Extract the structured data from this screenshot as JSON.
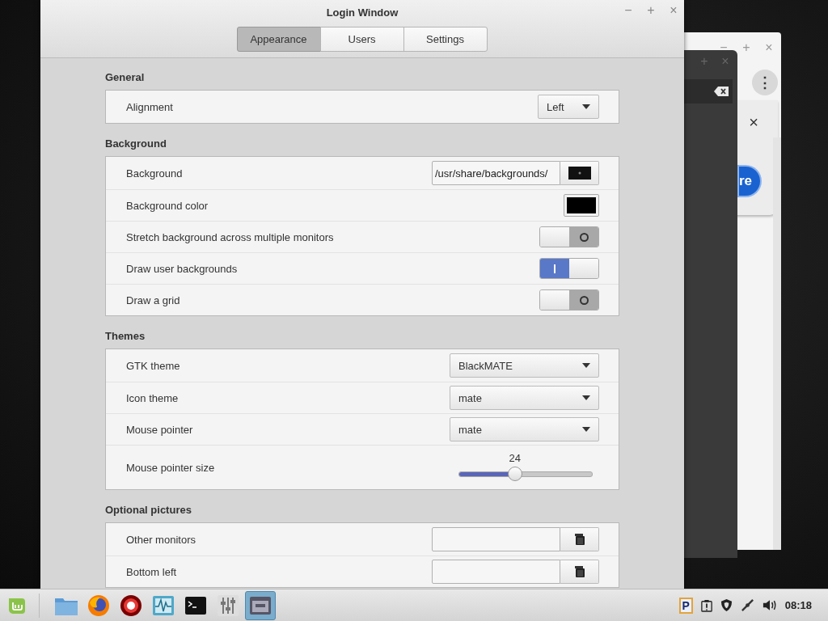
{
  "window": {
    "title": "Login Window",
    "controls": [
      "−",
      "+",
      "×"
    ],
    "tabs": [
      {
        "label": "Appearance",
        "selected": true
      },
      {
        "label": "Users",
        "selected": false
      },
      {
        "label": "Settings",
        "selected": false
      }
    ]
  },
  "sections": [
    {
      "title": "General",
      "rows": [
        {
          "kind": "short-combo",
          "label": "Alignment",
          "value": "Left"
        }
      ]
    },
    {
      "title": "Background",
      "rows": [
        {
          "kind": "image-file",
          "label": "Background",
          "value": "/usr/share/backgrounds/"
        },
        {
          "kind": "color",
          "label": "Background color",
          "color": "#000000"
        },
        {
          "kind": "switch",
          "label": "Stretch background across multiple monitors",
          "on": false
        },
        {
          "kind": "switch",
          "label": "Draw user backgrounds",
          "on": true
        },
        {
          "kind": "switch",
          "label": "Draw a grid",
          "on": false
        }
      ]
    },
    {
      "title": "Themes",
      "rows": [
        {
          "kind": "combo",
          "label": "GTK theme",
          "value": "BlackMATE"
        },
        {
          "kind": "combo",
          "label": "Icon theme",
          "value": "mate"
        },
        {
          "kind": "combo",
          "label": "Mouse pointer",
          "value": "mate"
        },
        {
          "kind": "slider",
          "label": "Mouse pointer size",
          "level": 0.42,
          "reading": "24"
        }
      ]
    },
    {
      "title": "Optional pictures",
      "rows": [
        {
          "kind": "file",
          "label": "Other monitors"
        },
        {
          "kind": "file",
          "label": "Bottom left"
        }
      ]
    }
  ],
  "browser_window": {
    "controls": [
      "−",
      "+",
      "×"
    ],
    "menu": "⋮",
    "close": "×",
    "button": "re"
  },
  "dark_window": {
    "controls": [
      "+",
      "×"
    ]
  },
  "taskbar": {
    "launchers": [
      {
        "kind": "folder",
        "selected": false
      },
      {
        "kind": "browser",
        "selected": false
      },
      {
        "kind": "ring",
        "selected": false
      },
      {
        "kind": "monitor",
        "selected": false
      },
      {
        "kind": "terminal",
        "selected": false
      },
      {
        "kind": "mixer",
        "selected": false
      },
      {
        "kind": "window",
        "selected": true
      }
    ],
    "tray_badge": "P",
    "clock": "08:18"
  }
}
